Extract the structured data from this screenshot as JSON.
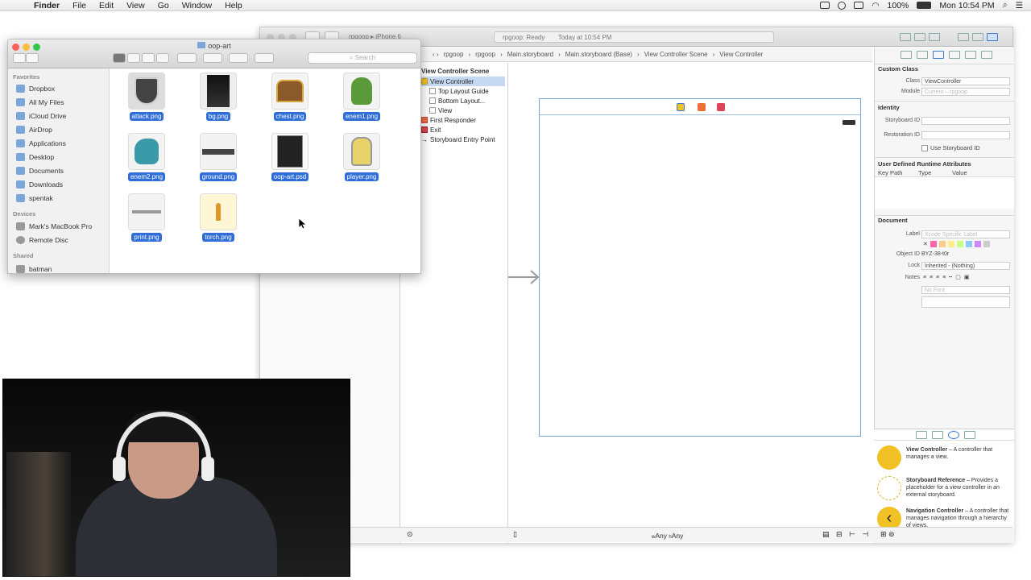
{
  "menubar": {
    "app": "Finder",
    "menus": [
      "File",
      "Edit",
      "View",
      "Go",
      "Window",
      "Help"
    ],
    "battery": "100%",
    "clock": "Mon 10:54 PM"
  },
  "finder": {
    "title": "oop-art",
    "search_placeholder": "Search",
    "sidebar": {
      "favorites_header": "Favorites",
      "favorites": [
        "Dropbox",
        "All My Files",
        "iCloud Drive",
        "AirDrop",
        "Applications",
        "Desktop",
        "Documents",
        "Downloads",
        "spentak"
      ],
      "devices_header": "Devices",
      "devices": [
        "Mark's MacBook Pro",
        "Remote Disc"
      ],
      "shared_header": "Shared",
      "shared": [
        "batman"
      ]
    },
    "files": [
      "attack.png",
      "bg.png",
      "chest.png",
      "enem1.png",
      "enem2.png",
      "ground.png",
      "oop-art.psd",
      "player.png",
      "print.png",
      "torch.png"
    ]
  },
  "xcode": {
    "scheme": "rpgoop",
    "device": "iPhone 6",
    "status": "rpgoop: Ready",
    "status_time": "Today at 10:54 PM",
    "jumpbar": [
      "rpgoop",
      "rpgoop",
      "Main.storyboard",
      "Main.storyboard (Base)",
      "View Controller Scene",
      "View Controller"
    ],
    "outline": {
      "scene": "View Controller Scene",
      "items": [
        "View Controller",
        "Top Layout Guide",
        "Bottom Layout...",
        "View",
        "First Responder",
        "Exit",
        "Storyboard Entry Point"
      ]
    },
    "inspector": {
      "custom_class_header": "Custom Class",
      "class_label": "Class",
      "class_value": "ViewController",
      "module_label": "Module",
      "module_value": "Current – rpgoop",
      "identity_header": "Identity",
      "storyboard_id_label": "Storyboard ID",
      "restoration_id_label": "Restoration ID",
      "use_storyboard_id": "Use Storyboard ID",
      "runtime_header": "User Defined Runtime Attributes",
      "col_key": "Key Path",
      "col_type": "Type",
      "col_value": "Value",
      "document_header": "Document",
      "label_label": "Label",
      "label_placeholder": "Xcode Specific Label",
      "object_id_label": "Object ID",
      "object_id_value": "BYZ-38-t0r",
      "lock_label": "Lock",
      "lock_value": "Inherited - (Nothing)",
      "notes_label": "Notes",
      "font_placeholder": "No Font"
    },
    "library": [
      {
        "title": "View Controller",
        "desc": " – A controller that manages a view."
      },
      {
        "title": "Storyboard Reference",
        "desc": " – Provides a placeholder for a view controller in an external storyboard."
      },
      {
        "title": "Navigation Controller",
        "desc": " – A controller that manages navigation through a hierarchy of views."
      }
    ],
    "size_class_w": "w",
    "size_class_w_val": "Any",
    "size_class_h": "h",
    "size_class_h_val": "Any"
  },
  "colors": {
    "selection": "#2f6ed8",
    "accent_yellow": "#f2c125"
  }
}
